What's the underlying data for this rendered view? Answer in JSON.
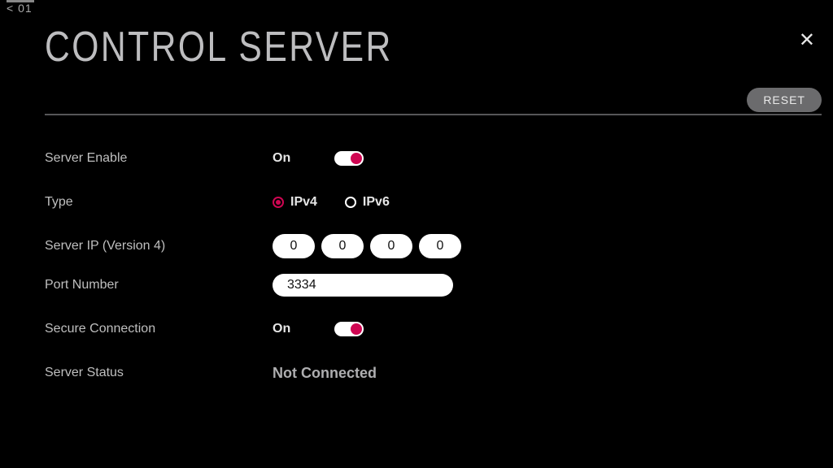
{
  "colors": {
    "accent": "#cf0652"
  },
  "back": {
    "label": "< 01"
  },
  "title": "CONTROL SERVER",
  "buttons": {
    "reset": "RESET",
    "close": "✕"
  },
  "fields": {
    "serverEnable": {
      "label": "Server Enable",
      "state_text": "On",
      "on": true
    },
    "type": {
      "label": "Type",
      "options": {
        "ipv4": "IPv4",
        "ipv6": "IPv6"
      },
      "selected": "ipv4"
    },
    "serverIp": {
      "label": "Server IP (Version 4)",
      "octets": [
        "0",
        "0",
        "0",
        "0"
      ]
    },
    "port": {
      "label": "Port Number",
      "value": "3334"
    },
    "secure": {
      "label": "Secure Connection",
      "state_text": "On",
      "on": true
    },
    "status": {
      "label": "Server Status",
      "value": "Not Connected"
    }
  }
}
